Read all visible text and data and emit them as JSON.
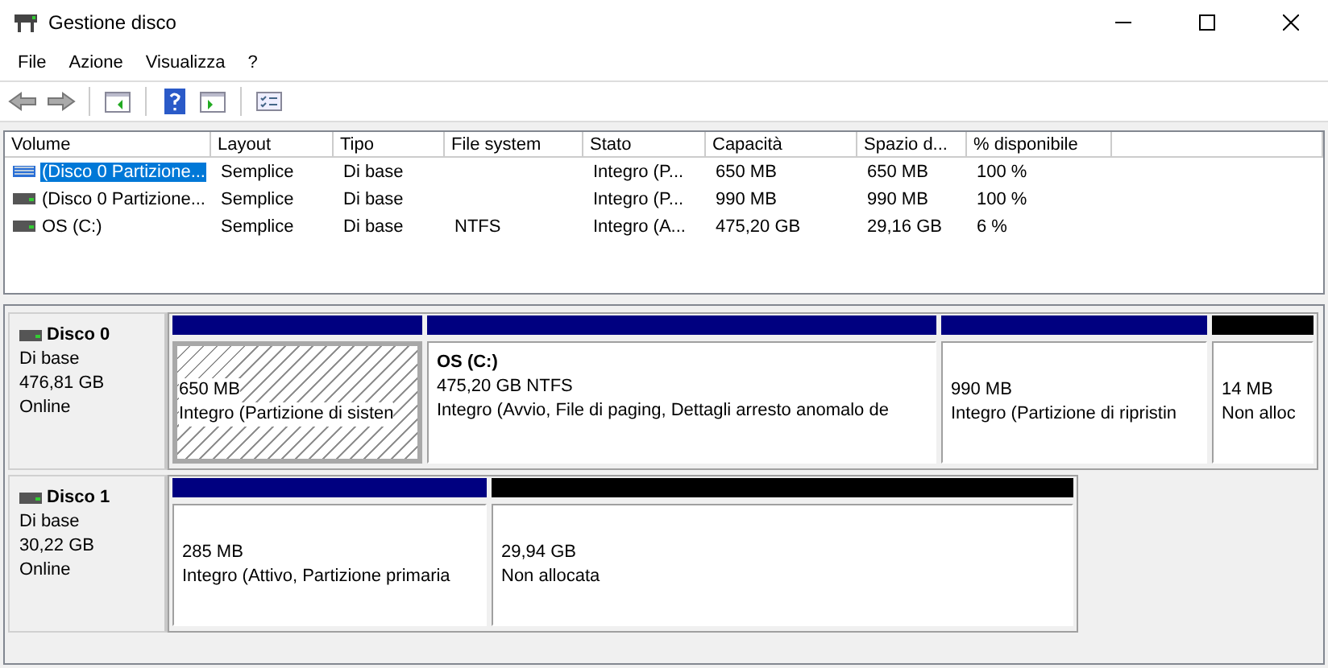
{
  "window": {
    "title": "Gestione disco"
  },
  "menu": [
    "File",
    "Azione",
    "Visualizza",
    "?"
  ],
  "table": {
    "columns": [
      "Volume",
      "Layout",
      "Tipo",
      "File system",
      "Stato",
      "Capacità",
      "Spazio d...",
      "% disponibile"
    ],
    "rows": [
      {
        "kind": "striped",
        "selected": true,
        "cells": [
          "(Disco 0 Partizione...",
          "Semplice",
          "Di base",
          "",
          "Integro (P...",
          "650 MB",
          "650 MB",
          "100 %"
        ]
      },
      {
        "kind": "plain",
        "selected": false,
        "cells": [
          "(Disco 0 Partizione...",
          "Semplice",
          "Di base",
          "",
          "Integro (P...",
          "990 MB",
          "990 MB",
          "100 %"
        ]
      },
      {
        "kind": "plain",
        "selected": false,
        "cells": [
          "OS (C:)",
          "Semplice",
          "Di base",
          "NTFS",
          "Integro (A...",
          "475,20 GB",
          "29,16 GB",
          "6 %"
        ]
      }
    ]
  },
  "disks": [
    {
      "name": "Disco 0",
      "type": "Di base",
      "size": "476,81 GB",
      "status": "Online",
      "partitions": [
        {
          "kind": "system",
          "selected": true,
          "size": "650 MB",
          "status": "Integro (Partizione di sisten"
        },
        {
          "kind": "primary",
          "selected": false,
          "name": "OS  (C:)",
          "size": "475,20 GB NTFS",
          "status": "Integro (Avvio, File di paging, Dettagli arresto anomalo de"
        },
        {
          "kind": "primary",
          "selected": false,
          "size": "990 MB",
          "status": "Integro (Partizione di ripristin"
        },
        {
          "kind": "unallocated",
          "selected": false,
          "size": "14 MB",
          "status": "Non alloc"
        }
      ]
    },
    {
      "name": "Disco 1",
      "type": "Di base",
      "size": "30,22 GB",
      "status": "Online",
      "partitions": [
        {
          "kind": "primary",
          "selected": false,
          "size": "285 MB",
          "status": "Integro (Attivo, Partizione primaria"
        },
        {
          "kind": "unallocated",
          "selected": false,
          "size": "29,94 GB",
          "status": "Non allocata"
        }
      ]
    }
  ]
}
